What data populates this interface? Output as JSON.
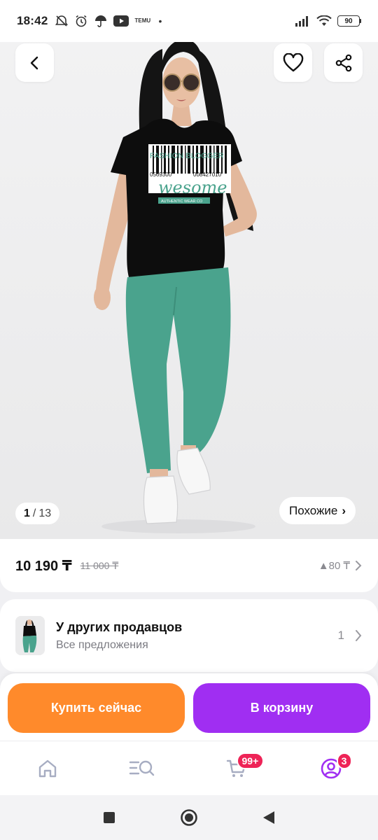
{
  "status_bar": {
    "time": "18:42",
    "icons_left": [
      "alarm-off-icon",
      "alarm-icon",
      "umbrella-icon",
      "youtube-icon",
      "temu-icon"
    ],
    "temu_label": "TEMU",
    "dot": "•",
    "icons_right": [
      "signal-icon",
      "wifi-icon",
      "battery-icon"
    ],
    "battery_level": "90"
  },
  "gallery": {
    "current": "1",
    "separator": "/",
    "total": "13",
    "similar_label": "Похожие",
    "similar_chevron": "›",
    "print_line1": "FASHION  BLOGGER",
    "print_code_left": "0569300",
    "print_code_right": "008427010",
    "print_script": "wesome",
    "print_ribbon": "AUTHENTIC WEAR CO"
  },
  "price": {
    "current": "10 190 ₸",
    "old": "11 000 ₸",
    "delta": "▲80 ₸"
  },
  "other_sellers": {
    "title": "У других продавцов",
    "subtitle": "Все предложения",
    "count": "1"
  },
  "actions": {
    "buy_now": "Купить сейчас",
    "add_to_cart": "В корзину"
  },
  "tabs": {
    "cart_badge": "99+",
    "profile_badge": "3"
  },
  "colors": {
    "buy_button": "#ff8a2b",
    "cart_button": "#a02ef2",
    "badge": "#ee2357",
    "pants": "#4aa38d"
  }
}
